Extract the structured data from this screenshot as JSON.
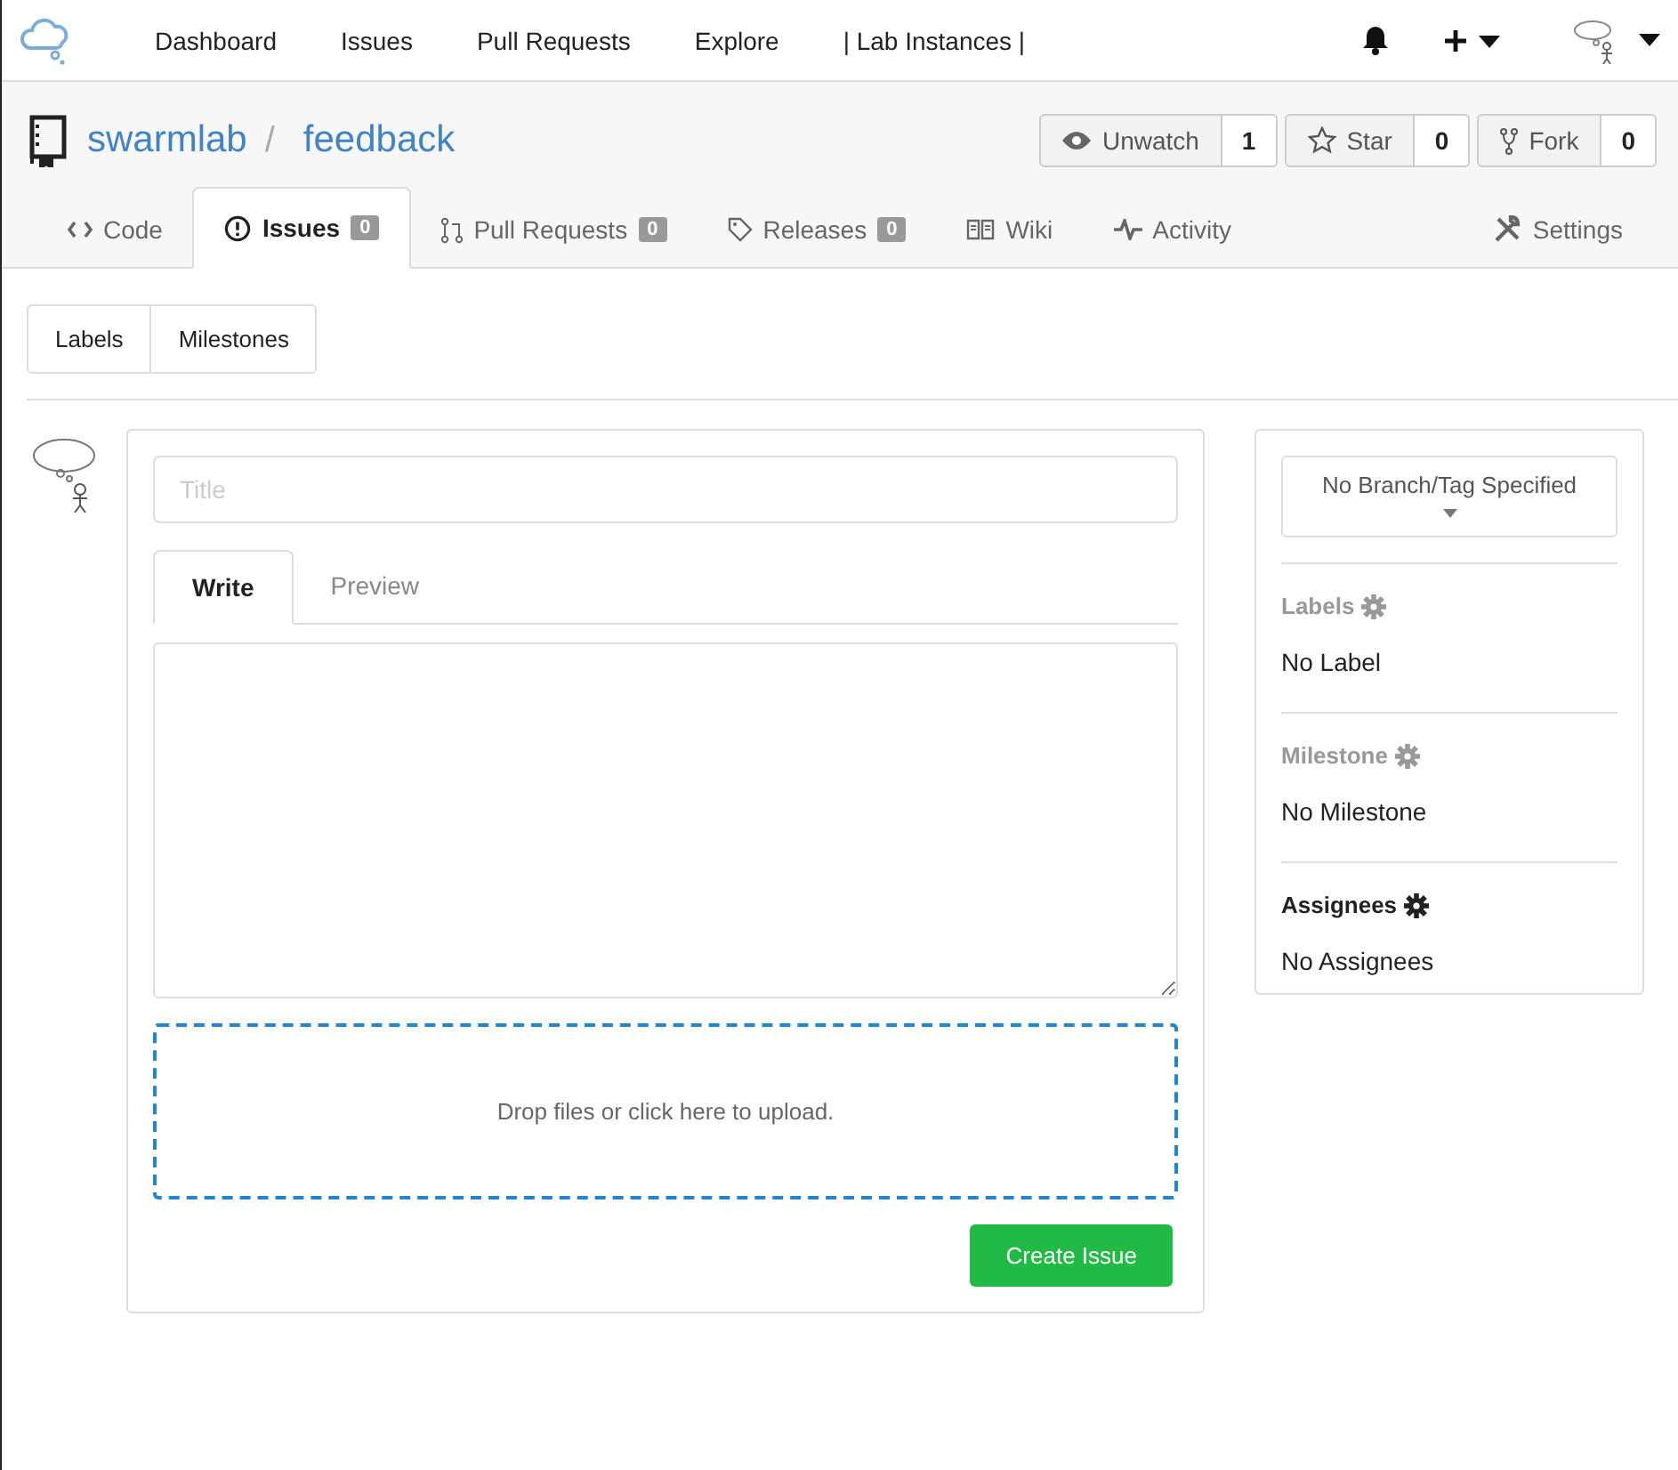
{
  "nav": {
    "items": [
      "Dashboard",
      "Issues",
      "Pull Requests",
      "Explore",
      "| Lab Instances |"
    ]
  },
  "repo": {
    "owner": "swarmlab",
    "separator": "/",
    "name": "feedback",
    "actions": [
      {
        "label": "Unwatch",
        "count": "1"
      },
      {
        "label": "Star",
        "count": "0"
      },
      {
        "label": "Fork",
        "count": "0"
      }
    ]
  },
  "tabs": [
    {
      "label": "Code",
      "selected": false
    },
    {
      "label": "Issues",
      "count": "0",
      "selected": true
    },
    {
      "label": "Pull Requests",
      "count": "0",
      "selected": false
    },
    {
      "label": "Releases",
      "count": "0",
      "selected": false
    },
    {
      "label": "Wiki",
      "selected": false
    },
    {
      "label": "Activity",
      "selected": false
    }
  ],
  "settings_tab": {
    "label": "Settings"
  },
  "subnav": [
    "Labels",
    "Milestones"
  ],
  "form": {
    "title_placeholder": "Title",
    "editor_tabs": [
      {
        "label": "Write",
        "selected": true
      },
      {
        "label": "Preview",
        "selected": false
      }
    ],
    "dropzone": "Drop files or click here to upload.",
    "submit": "Create Issue"
  },
  "sidebar": {
    "branch": "No Branch/Tag Specified",
    "sections": [
      {
        "title": "Labels",
        "value": "No Label",
        "disabled": true
      },
      {
        "title": "Milestone",
        "value": "No Milestone",
        "disabled": true
      },
      {
        "title": "Assignees",
        "value": "No Assignees",
        "disabled": false
      }
    ]
  }
}
